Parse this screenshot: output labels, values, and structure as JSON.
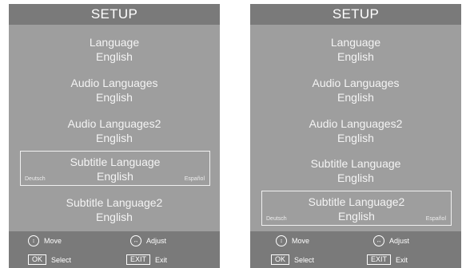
{
  "title": "SETUP",
  "menu": [
    {
      "label": "Language",
      "value": "English"
    },
    {
      "label": "Audio Languages",
      "value": "English"
    },
    {
      "label": "Audio Languages2",
      "value": "English"
    },
    {
      "label": "Subtitle Language",
      "value": "English"
    },
    {
      "label": "Subtitle Language2",
      "value": "English"
    }
  ],
  "options": {
    "left": "Deutsch",
    "right": "Español"
  },
  "footer": {
    "move": "Move",
    "adjust": "Adjust",
    "ok_key": "OK",
    "select": "Select",
    "exit_key": "EXIT",
    "exit": "Exit"
  },
  "icons": {
    "move": "up-down-arrows-icon",
    "adjust": "left-right-arrows-icon"
  },
  "colors": {
    "panel_bg": "#9e9e9e",
    "bar_bg": "#7a7a7a",
    "text": "#ffffff"
  },
  "screens": [
    {
      "name": "subtitle-language-selected",
      "selected_index": 3
    },
    {
      "name": "subtitle-language2-selected",
      "selected_index": 4
    }
  ]
}
